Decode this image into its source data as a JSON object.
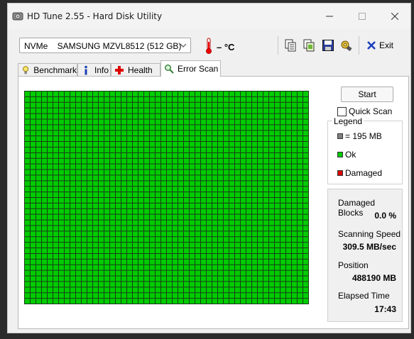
{
  "window": {
    "title": "HD Tune 2.55 - Hard Disk Utility"
  },
  "toolbar": {
    "drive": "NVMe    SAMSUNG MZVL8512 (512 GB)",
    "temperature": "– °C",
    "exit_label": "Exit"
  },
  "tabs": [
    {
      "label": "Benchmark",
      "icon": "benchmark-icon"
    },
    {
      "label": "Info",
      "icon": "info-icon"
    },
    {
      "label": "Health",
      "icon": "health-icon"
    },
    {
      "label": "Error Scan",
      "icon": "error-scan-icon",
      "active": true
    }
  ],
  "scan": {
    "start_label": "Start",
    "quick_scan_label": "Quick Scan",
    "quick_scan_checked": false,
    "block_grid": {
      "columns": 50,
      "rows": 38,
      "status": "ok"
    }
  },
  "legend": {
    "title": "Legend",
    "block_size": "= 195 MB",
    "ok": "Ok",
    "damaged": "Damaged"
  },
  "stats": {
    "damaged_blocks_label": "Damaged Blocks",
    "damaged_blocks_value": "0.0 %",
    "scanning_speed_label": "Scanning Speed",
    "scanning_speed_value": "309.5 MB/sec",
    "position_label": "Position",
    "position_value": "488190 MB",
    "elapsed_label": "Elapsed Time",
    "elapsed_value": "17:43"
  },
  "colors": {
    "ok": "#00cc00",
    "damaged": "#dd0000",
    "block": "#808080",
    "grid_line": "#1a3d1a"
  }
}
